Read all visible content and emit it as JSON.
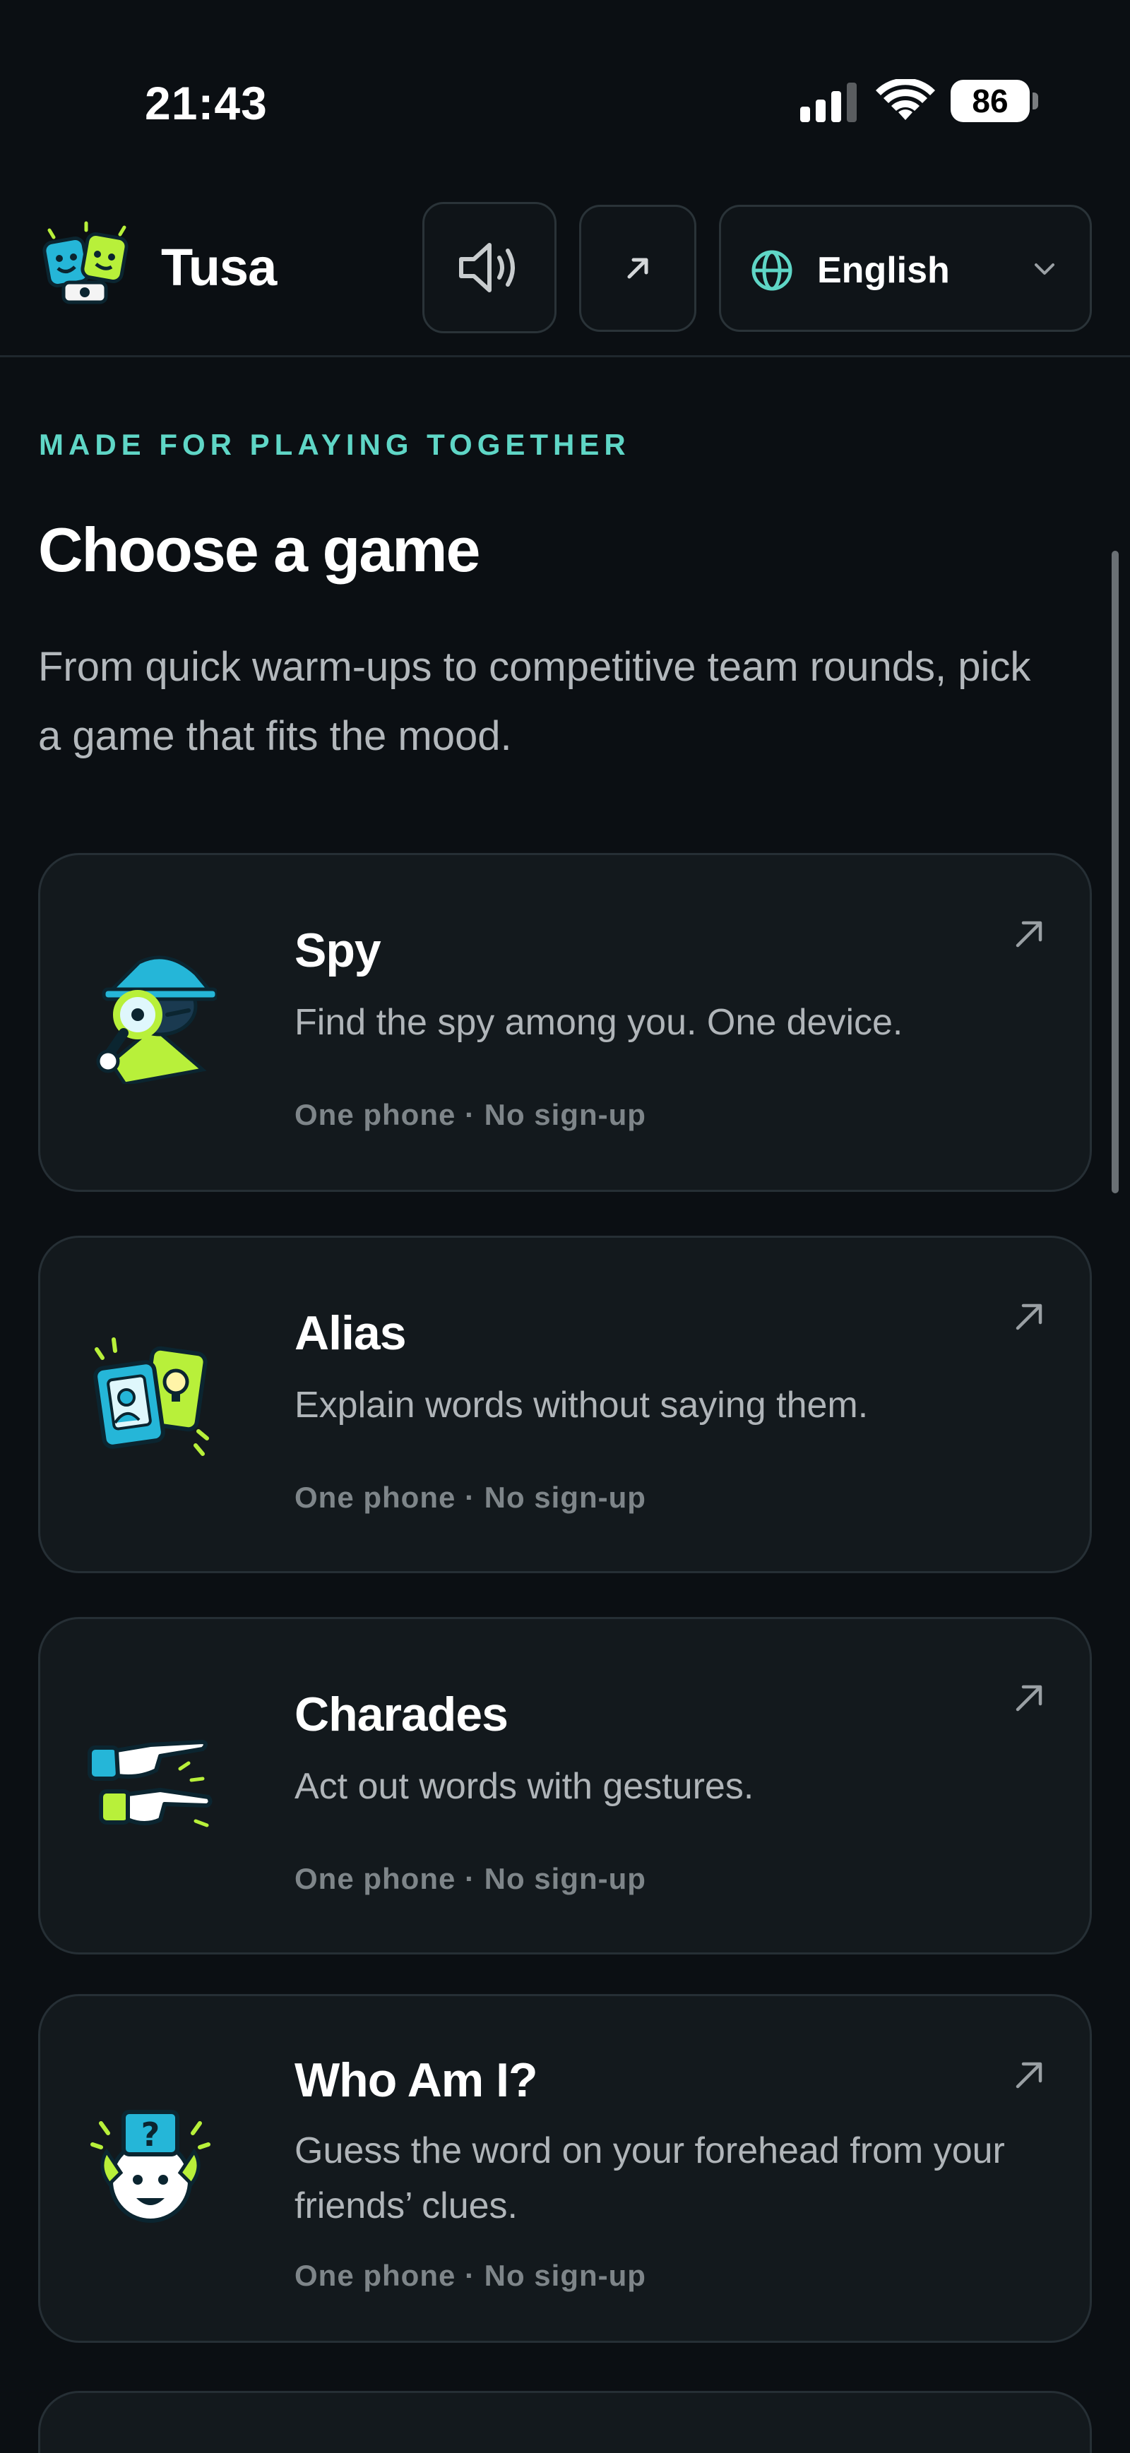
{
  "status_bar": {
    "time": "21:43",
    "battery": "86"
  },
  "header": {
    "app_name": "Tusa",
    "sound_icon": "speaker-icon",
    "share_icon": "arrow-up-right-icon",
    "language": {
      "icon": "globe-icon",
      "selected": "English"
    }
  },
  "hero": {
    "eyebrow": "MADE FOR PLAYING TOGETHER",
    "title": "Choose a game",
    "subtitle": "From quick warm-ups to competitive team rounds, pick a game that fits the mood."
  },
  "games": [
    {
      "title": "Spy",
      "description": "Find the spy among you. One device.",
      "meta": "One phone · No sign-up",
      "icon": "spy-icon"
    },
    {
      "title": "Alias",
      "description": "Explain words without saying them.",
      "meta": "One phone · No sign-up",
      "icon": "alias-cards-icon"
    },
    {
      "title": "Charades",
      "description": "Act out words with gestures.",
      "meta": "One phone · No sign-up",
      "icon": "charades-hands-icon"
    },
    {
      "title": "Who Am I?",
      "description": "Guess the word on your forehead from your friends’ clues.",
      "meta": "One phone · No sign-up",
      "icon": "who-am-i-icon"
    }
  ],
  "colors": {
    "background": "#0b0f13",
    "card": "#13191d",
    "accent": "#5fd6c6",
    "lime": "#b8f03a",
    "cyan": "#25b6d8"
  }
}
